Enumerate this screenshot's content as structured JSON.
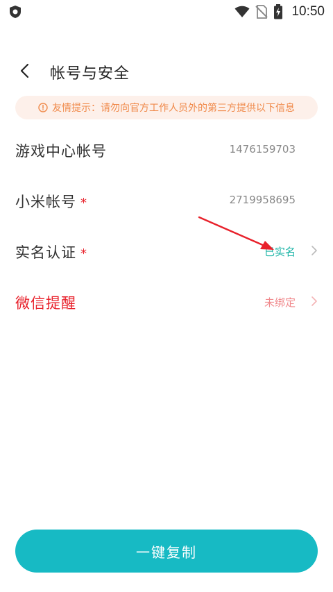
{
  "status_bar": {
    "time": "10:50",
    "icons": [
      "shield-icon",
      "wifi-icon",
      "no-sim-icon",
      "battery-charging-icon"
    ]
  },
  "header": {
    "title": "帐号与安全",
    "back_icon": "back-arrow-icon"
  },
  "tip": {
    "icon": "info-circle-icon",
    "text": "友情提示：请勿向官方工作人员外的第三方提供以下信息",
    "color": "#f08a4b",
    "background": "#fdf0ea"
  },
  "rows": [
    {
      "label": "游戏中心帐号",
      "value": "1476159703",
      "required": false,
      "has_chevron": false
    },
    {
      "label": "小米帐号",
      "value": "2719958695",
      "required": true,
      "star": "*",
      "has_chevron": false
    },
    {
      "label": "实名认证",
      "value": "已实名",
      "required": true,
      "star": "*",
      "has_chevron": true,
      "value_color": "#17b3a5"
    },
    {
      "label": "微信提醒",
      "value": "未绑定",
      "required": false,
      "has_chevron": true,
      "label_color": "#e8212b",
      "value_color": "#f0898c"
    }
  ],
  "footer": {
    "copy_button_label": "一键复制",
    "button_color": "#17bac4"
  },
  "annotation": {
    "arrow_color": "#e8212b"
  }
}
